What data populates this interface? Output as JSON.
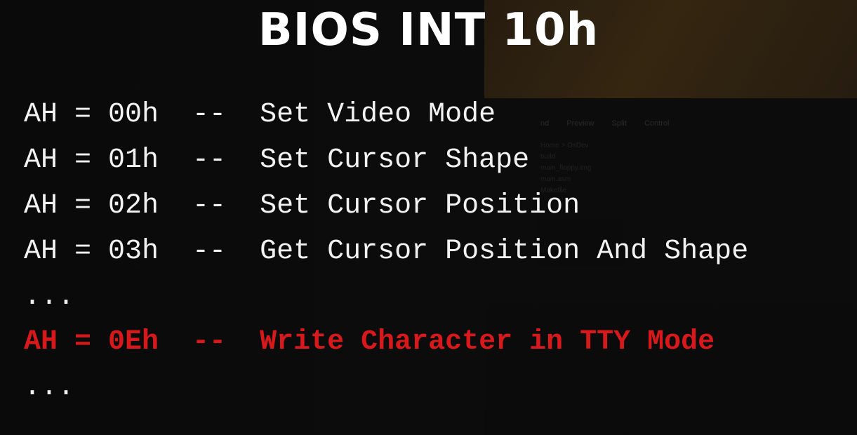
{
  "title": "BIOS INT 10h",
  "lines": [
    {
      "code": "AH = 00h",
      "sep": "--",
      "desc": "Set Video Mode"
    },
    {
      "code": "AH = 01h",
      "sep": "--",
      "desc": "Set Cursor Shape"
    },
    {
      "code": "AH = 02h",
      "sep": "--",
      "desc": "Set Cursor Position"
    },
    {
      "code": "AH = 03h",
      "sep": "--",
      "desc": "Get Cursor Position And Shape"
    }
  ],
  "ellipsis_1": "...",
  "highlight": {
    "code": "AH = 0Eh",
    "sep": "--",
    "desc": "Write Character in TTY Mode",
    "color": "#d7191c"
  },
  "ellipsis_2": "...",
  "background_window": {
    "toolbar": [
      "nd",
      "Preview",
      "Split",
      "Control"
    ],
    "tree": [
      "Home > OsDev",
      "build",
      "main_floppy.img",
      "main.asm",
      "Makefile"
    ]
  }
}
